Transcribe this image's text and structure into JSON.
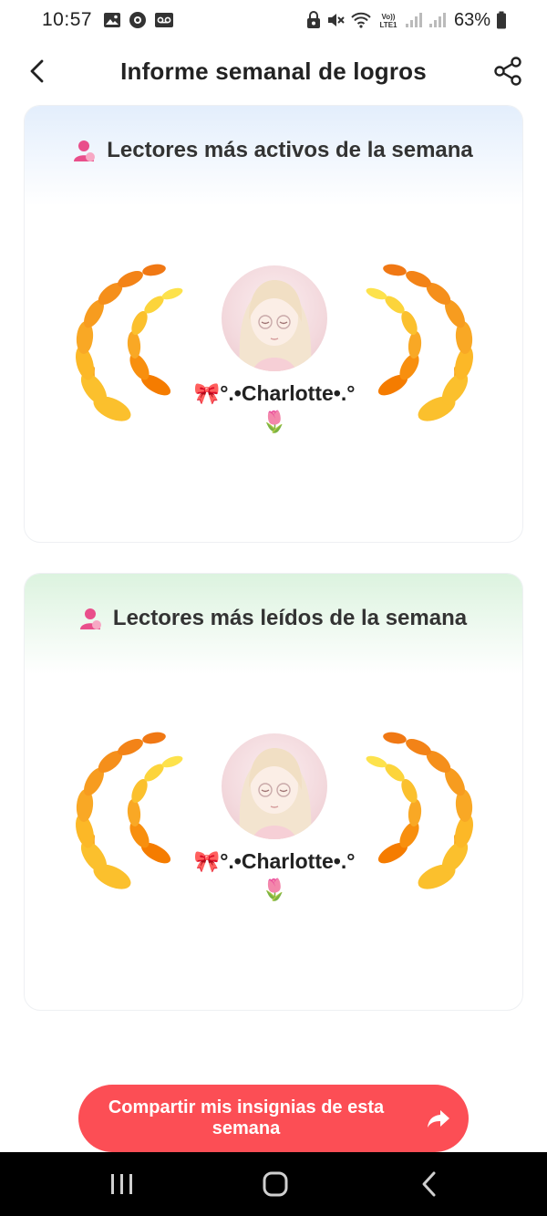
{
  "status_bar": {
    "time": "10:57",
    "battery": "63%",
    "icons": [
      "image-icon",
      "media-icon",
      "voicemail-icon",
      "notification-lock-icon",
      "mute-icon",
      "wifi-icon",
      "volte-icon",
      "signal-icon",
      "signal-icon",
      "battery-icon"
    ]
  },
  "header": {
    "title": "Informe semanal de logros",
    "back_icon": "chevron-left-icon",
    "share_icon": "share-icon"
  },
  "cards": [
    {
      "title": "Lectores más activos de la semana",
      "icon": "person-icon",
      "header_color": "#e3eefc",
      "username": "🎀°.•Charlotte•.°🌷",
      "laurel_color": "#f5a623"
    },
    {
      "title": "Lectores más leídos de la semana",
      "icon": "person-icon",
      "header_color": "#dcf3df",
      "username": "🎀°.•Charlotte•.°🌷",
      "laurel_color": "#f5a623"
    }
  ],
  "share_button": {
    "label": "Compartir mis insignias de esta semana",
    "icon": "share-arrow-icon",
    "color": "#fc4e55"
  },
  "nav_bar": {
    "items": [
      "recents-icon",
      "home-icon",
      "back-icon"
    ]
  },
  "colors": {
    "accent_pink": "#ec4f8a",
    "button_red": "#fc4e55",
    "laurel_yellow": "#fbc02d",
    "laurel_orange": "#f57c00"
  }
}
